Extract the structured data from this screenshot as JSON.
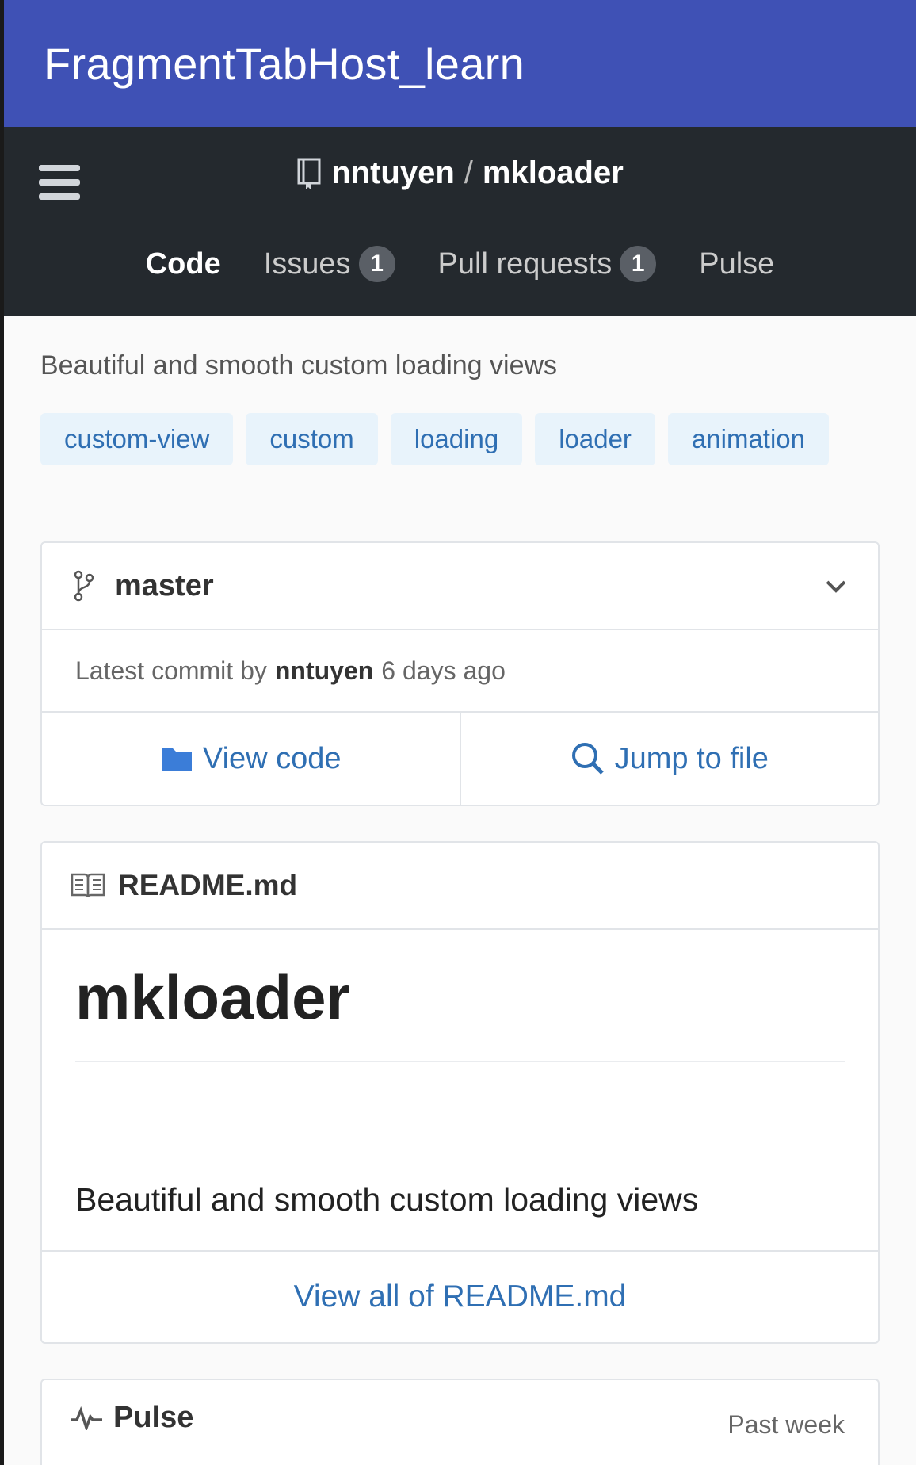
{
  "app": {
    "title": "FragmentTabHost_learn"
  },
  "repo": {
    "owner": "nntuyen",
    "separator": "/",
    "name": "mkloader"
  },
  "nav": {
    "code": "Code",
    "issues": "Issues",
    "issues_count": "1",
    "pulls": "Pull requests",
    "pulls_count": "1",
    "pulse": "Pulse"
  },
  "description": "Beautiful and smooth custom loading views",
  "topics": [
    "custom-view",
    "custom",
    "loading",
    "loader",
    "animation"
  ],
  "branch": {
    "name": "master"
  },
  "commit": {
    "prefix": "Latest commit by",
    "author": "nntuyen",
    "time": "6 days ago"
  },
  "actions": {
    "view_code": "View code",
    "jump_to_file": "Jump to file"
  },
  "readme": {
    "filename": "README.md",
    "heading": "mkloader",
    "paragraph": "Beautiful and smooth custom loading views",
    "view_all": "View all of README.md"
  },
  "pulse": {
    "title": "Pulse",
    "range": "Past week"
  },
  "colors": {
    "appbar": "#3f51b5",
    "header": "#24292e",
    "link": "#2f6fb3",
    "topic_bg": "#e8f3fb"
  },
  "icons": [
    "menu-icon",
    "repo-icon",
    "branch-icon",
    "chevron-down-icon",
    "folder-icon",
    "search-icon",
    "book-icon",
    "pulse-icon"
  ]
}
